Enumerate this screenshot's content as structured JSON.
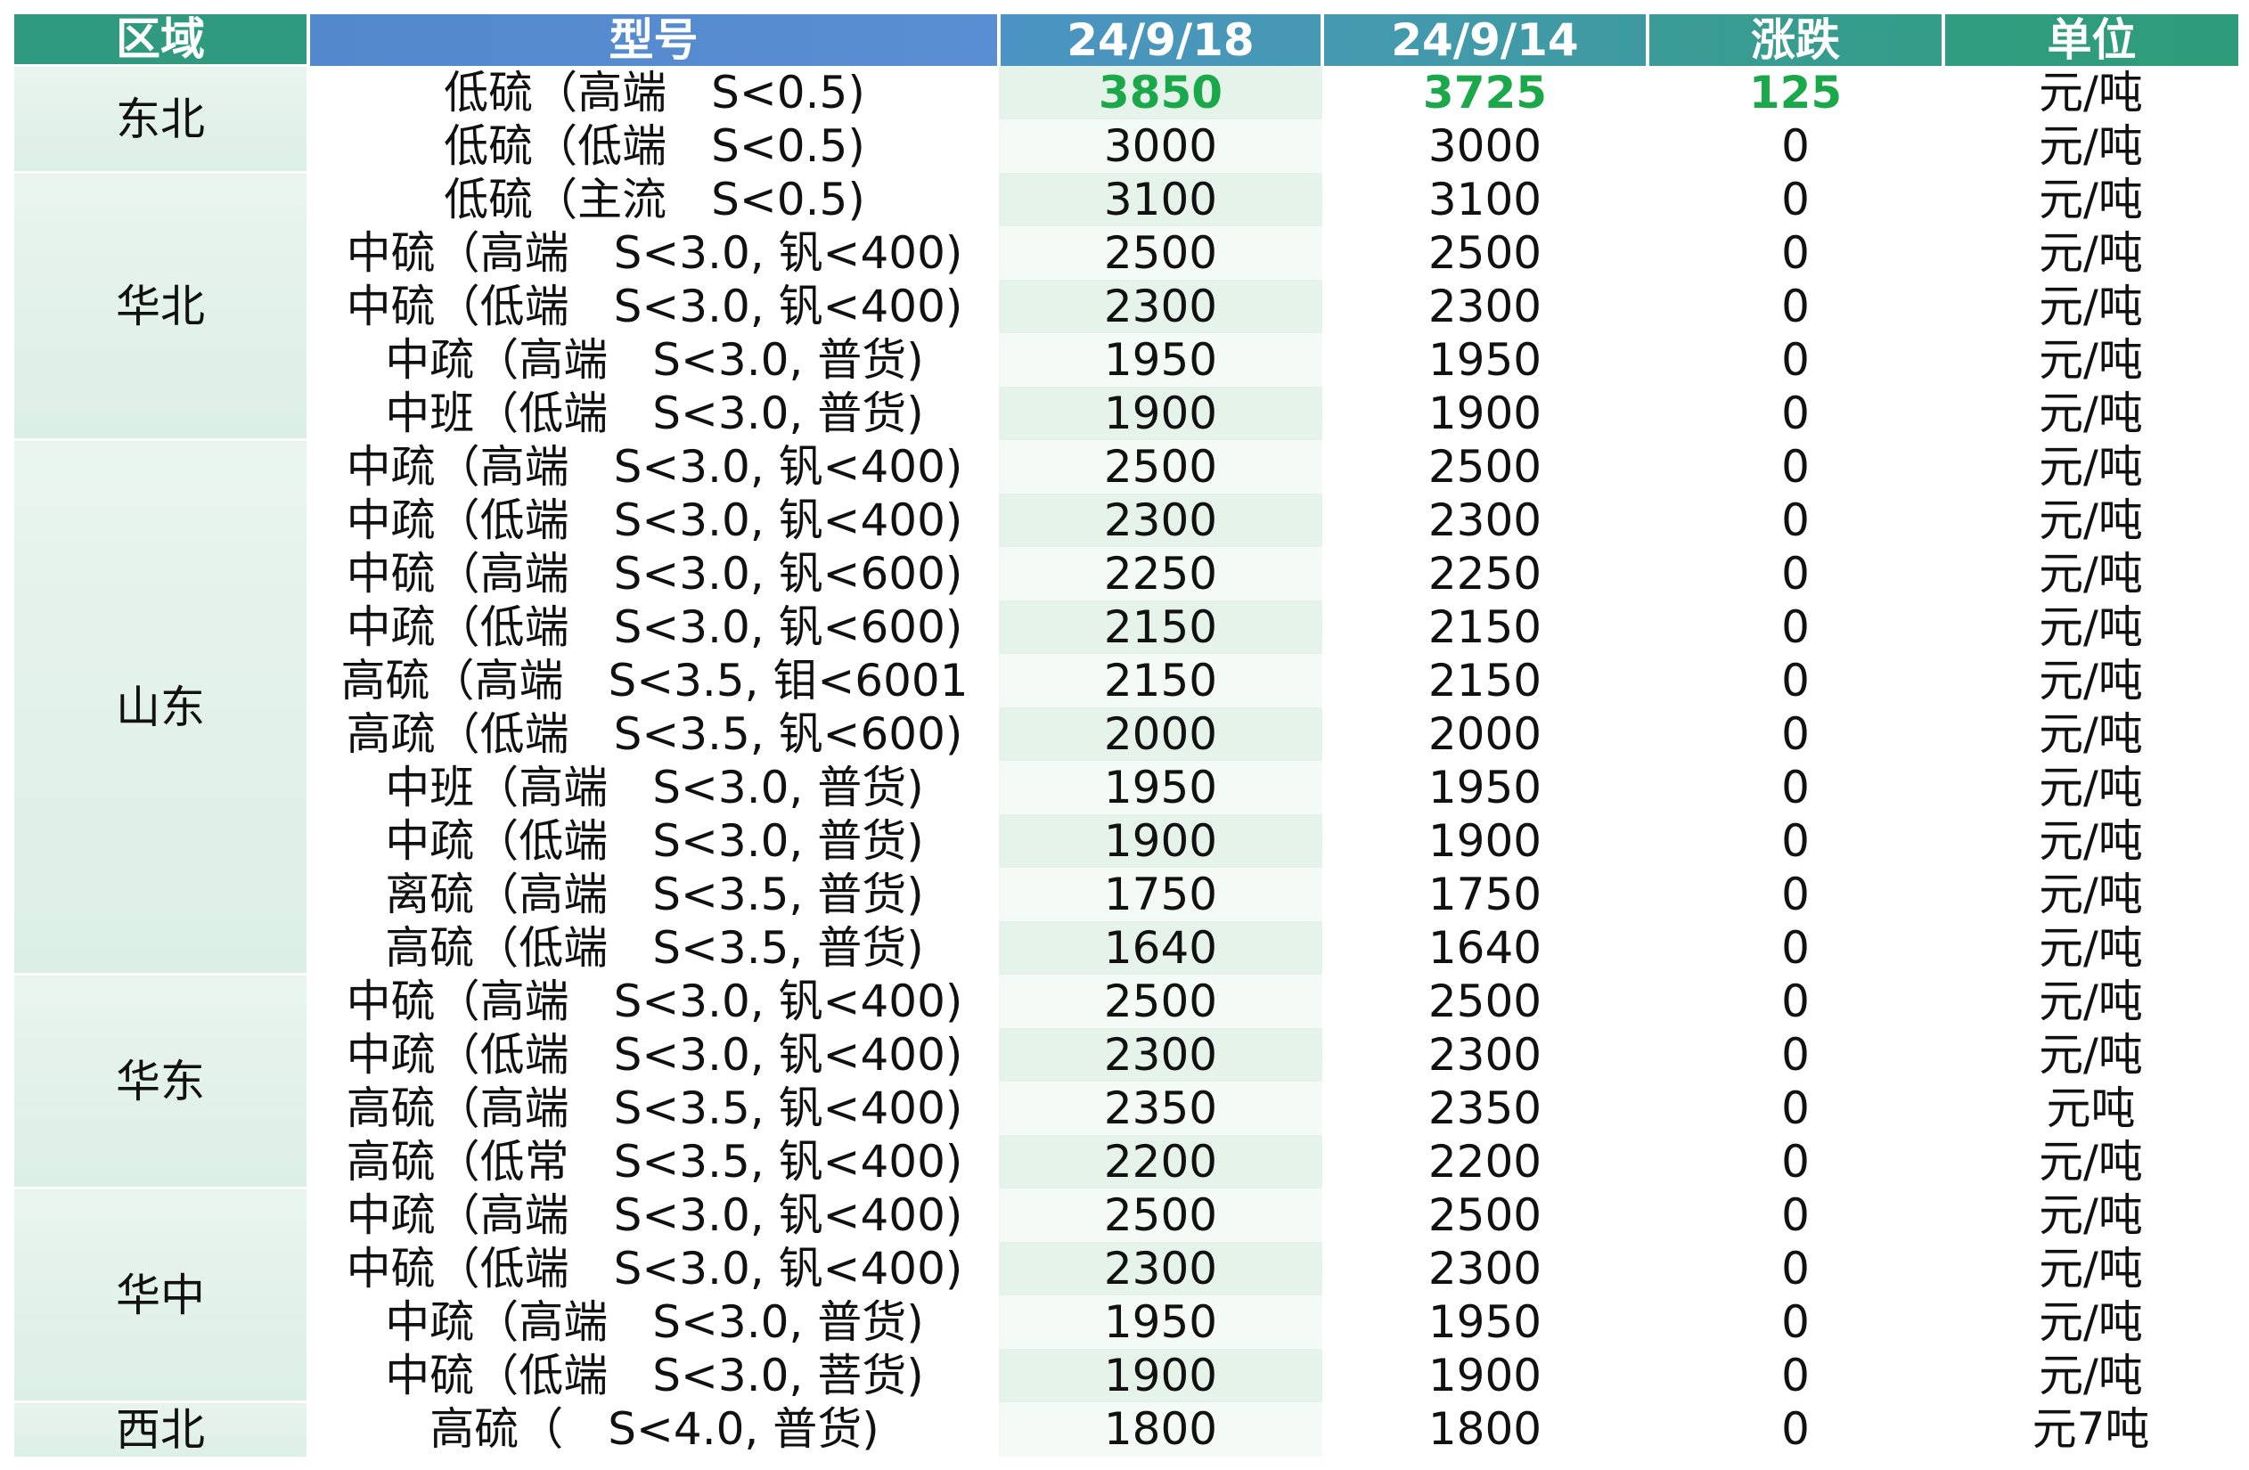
{
  "headers": {
    "region": "区域",
    "model": "型号",
    "date1": "24/9/18",
    "date2": "24/9/14",
    "change": "涨跌",
    "unit": "单位"
  },
  "regions": [
    {
      "name": "东北",
      "rows": [
        {
          "model": "低硫（高端　S<0.5)",
          "d1": "3850",
          "d2": "3725",
          "chg": "125",
          "unit": "元/吨"
        },
        {
          "model": "低硫（低端　S<0.5)",
          "d1": "3000",
          "d2": "3000",
          "chg": "0",
          "unit": "元/吨"
        }
      ]
    },
    {
      "name": "华北",
      "rows": [
        {
          "model": "低硫（主流　S<0.5)",
          "d1": "3100",
          "d2": "3100",
          "chg": "0",
          "unit": "元/吨"
        },
        {
          "model": "中硫（高端　S<3.0, 钒<400)",
          "d1": "2500",
          "d2": "2500",
          "chg": "0",
          "unit": "元/吨"
        },
        {
          "model": "中硫（低端　S<3.0, 钒<400)",
          "d1": "2300",
          "d2": "2300",
          "chg": "0",
          "unit": "元/吨"
        },
        {
          "model": "中疏（高端　S<3.0, 普货)",
          "d1": "1950",
          "d2": "1950",
          "chg": "0",
          "unit": "元/吨"
        },
        {
          "model": "中班（低端　S<3.0, 普货)",
          "d1": "1900",
          "d2": "1900",
          "chg": "0",
          "unit": "元/吨"
        }
      ]
    },
    {
      "name": "山东",
      "rows": [
        {
          "model": "中疏（高端　S<3.0, 钒<400)",
          "d1": "2500",
          "d2": "2500",
          "chg": "0",
          "unit": "元/吨"
        },
        {
          "model": "中疏（低端　S<3.0, 钒<400)",
          "d1": "2300",
          "d2": "2300",
          "chg": "0",
          "unit": "元/吨"
        },
        {
          "model": "中硫（高端　S<3.0, 钒<600)",
          "d1": "2250",
          "d2": "2250",
          "chg": "0",
          "unit": "元/吨"
        },
        {
          "model": "中疏（低端　S<3.0, 钒<600)",
          "d1": "2150",
          "d2": "2150",
          "chg": "0",
          "unit": "元/吨"
        },
        {
          "model": "高硫（高端　S<3.5, 钼<6001",
          "d1": "2150",
          "d2": "2150",
          "chg": "0",
          "unit": "元/吨"
        },
        {
          "model": "高疏（低端　S<3.5, 钒<600)",
          "d1": "2000",
          "d2": "2000",
          "chg": "0",
          "unit": "元/吨"
        },
        {
          "model": "中班（高端　S<3.0, 普货)",
          "d1": "1950",
          "d2": "1950",
          "chg": "0",
          "unit": "元/吨"
        },
        {
          "model": "中疏（低端　S<3.0, 普货)",
          "d1": "1900",
          "d2": "1900",
          "chg": "0",
          "unit": "元/吨"
        },
        {
          "model": "离硫（高端　S<3.5, 普货)",
          "d1": "1750",
          "d2": "1750",
          "chg": "0",
          "unit": "元/吨"
        },
        {
          "model": "高硫（低端　S<3.5, 普货)",
          "d1": "1640",
          "d2": "1640",
          "chg": "0",
          "unit": "元/吨"
        }
      ]
    },
    {
      "name": "华东",
      "rows": [
        {
          "model": "中硫（高端　S<3.0, 钒<400)",
          "d1": "2500",
          "d2": "2500",
          "chg": "0",
          "unit": "元/吨"
        },
        {
          "model": "中疏（低端　S<3.0, 钒<400)",
          "d1": "2300",
          "d2": "2300",
          "chg": "0",
          "unit": "元/吨"
        },
        {
          "model": "高硫（高端　S<3.5, 钒<400)",
          "d1": "2350",
          "d2": "2350",
          "chg": "0",
          "unit": "元吨"
        },
        {
          "model": "高硫（低常　S<3.5, 钒<400)",
          "d1": "2200",
          "d2": "2200",
          "chg": "0",
          "unit": "元/吨"
        }
      ]
    },
    {
      "name": "华中",
      "rows": [
        {
          "model": "中疏（高端　S<3.0, 钒<400)",
          "d1": "2500",
          "d2": "2500",
          "chg": "0",
          "unit": "元/吨"
        },
        {
          "model": "中硫（低端　S<3.0, 钒<400)",
          "d1": "2300",
          "d2": "2300",
          "chg": "0",
          "unit": "元/吨"
        },
        {
          "model": "中疏（高端　S<3.0, 普货)",
          "d1": "1950",
          "d2": "1950",
          "chg": "0",
          "unit": "元/吨"
        },
        {
          "model": "中硫（低端　S<3.0, 菩货)",
          "d1": "1900",
          "d2": "1900",
          "chg": "0",
          "unit": "元/吨"
        }
      ]
    },
    {
      "name": "西北",
      "rows": [
        {
          "model": "高硫（　S<4.0, 普货)",
          "d1": "1800",
          "d2": "1800",
          "chg": "0",
          "unit": "元7吨"
        }
      ]
    }
  ],
  "highlight_color": "#1aa84a"
}
